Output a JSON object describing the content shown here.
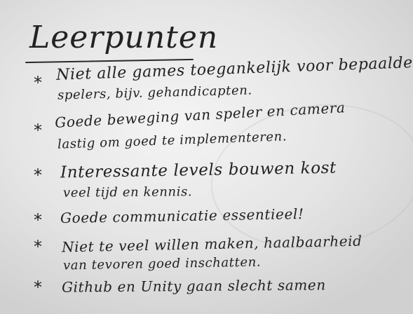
{
  "whiteboard": {
    "title": "Leerpunten",
    "bullet_symbol": "*",
    "items": [
      {
        "lines": [
          "Niet alle games toegankelijk voor bepaalde",
          "spelers, bijv. gehandicapten."
        ]
      },
      {
        "lines": [
          "Goede beweging van speler en camera",
          "lastig om goed te implementeren."
        ]
      },
      {
        "lines": [
          "Interessante levels bouwen kost",
          "veel tijd en kennis."
        ]
      },
      {
        "lines": [
          "Goede communicatie essentieel!"
        ]
      },
      {
        "lines": [
          "Niet te veel willen maken, haalbaarheid",
          "van tevoren goed inschatten."
        ]
      },
      {
        "lines": [
          "Github en Unity gaan slecht samen"
        ]
      }
    ]
  }
}
